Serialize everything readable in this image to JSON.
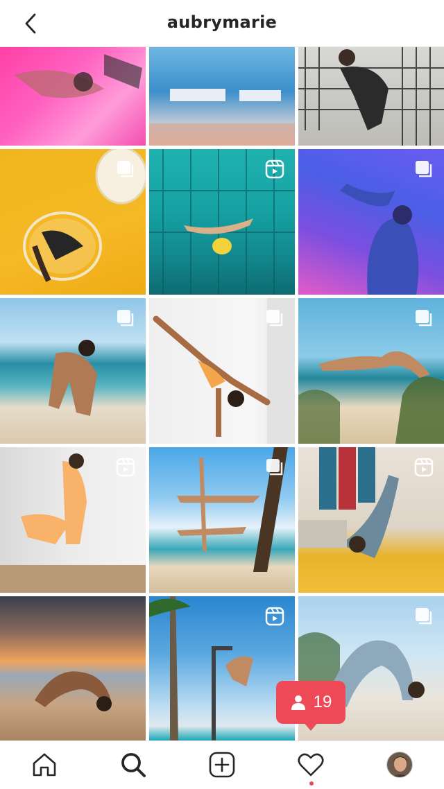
{
  "header": {
    "username": "aubrymarie",
    "back_icon": "chevron-left-icon"
  },
  "grid": {
    "posts": [
      {
        "name": "post-1",
        "badge": "none"
      },
      {
        "name": "post-2",
        "badge": "none"
      },
      {
        "name": "post-3",
        "badge": "none"
      },
      {
        "name": "post-4",
        "badge": "multi-photo"
      },
      {
        "name": "post-5",
        "badge": "reel"
      },
      {
        "name": "post-6",
        "badge": "multi-photo"
      },
      {
        "name": "post-7",
        "badge": "multi-photo"
      },
      {
        "name": "post-8",
        "badge": "multi-photo"
      },
      {
        "name": "post-9",
        "badge": "multi-photo"
      },
      {
        "name": "post-10",
        "badge": "reel"
      },
      {
        "name": "post-11",
        "badge": "multi-photo"
      },
      {
        "name": "post-12",
        "badge": "reel"
      },
      {
        "name": "post-13",
        "badge": "none"
      },
      {
        "name": "post-14",
        "badge": "reel"
      },
      {
        "name": "post-15",
        "badge": "multi-photo"
      }
    ]
  },
  "activity": {
    "follower_count": "19",
    "icon": "person-icon",
    "color": "#ed4956"
  },
  "bottom_nav": {
    "items": [
      "home-icon",
      "search-icon",
      "new-post-icon",
      "activity-heart-icon",
      "profile-avatar"
    ],
    "notification_dot_color": "#ed4956"
  }
}
